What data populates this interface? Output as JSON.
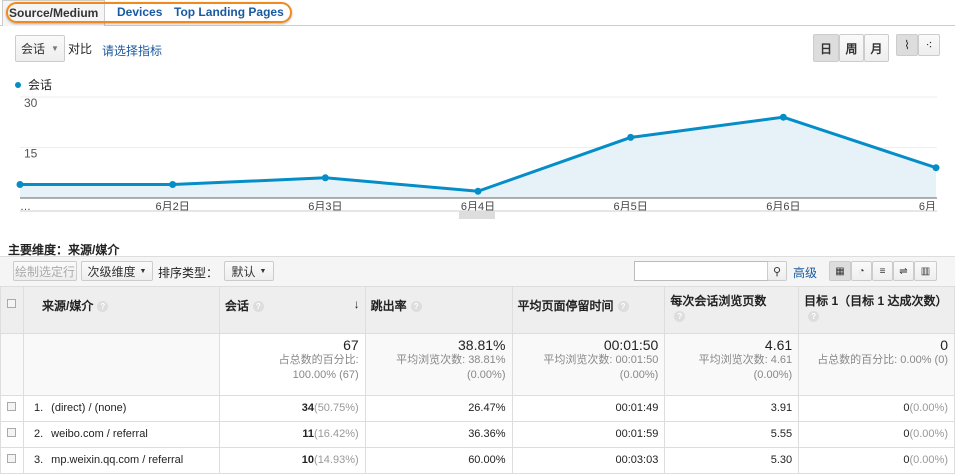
{
  "tabs": [
    "Source/Medium",
    "Devices",
    "Top Landing Pages"
  ],
  "metric_select": "会话",
  "compare_label": "对比",
  "choose_metric": "请选择指标",
  "period": [
    "日",
    "周",
    "月"
  ],
  "legend": "会话",
  "chart_data": {
    "type": "line",
    "series": [
      {
        "name": "会话",
        "values": [
          4,
          4,
          6,
          2,
          18,
          24,
          9
        ]
      }
    ],
    "categories": [
      "…",
      "6月2日",
      "6月3日",
      "6月4日",
      "6月5日",
      "6月6日",
      "6月"
    ],
    "yticks": [
      "30",
      "15"
    ],
    "ylim": [
      0,
      30
    ],
    "color": "#058dc7"
  },
  "primary_dim_label": "主要维度：",
  "primary_dim": "来源/媒介",
  "toolbar": {
    "plot_rows": "绘制选定行",
    "secondary": "次级维度",
    "sort_label": "排序类型：",
    "sort": "默认",
    "advanced": "高级",
    "search_placeholder": ""
  },
  "columns": [
    "来源/媒介",
    "会话",
    "跳出率",
    "平均页面停留时间",
    "每次会话浏览页数",
    "目标 1（目标 1 达成次数）"
  ],
  "totals": {
    "sessions": "67",
    "sessions_sub1": "占总数的百分比:",
    "sessions_sub2": "100.00% (67)",
    "bounce": "38.81%",
    "bounce_sub1": "平均浏览次数: 38.81%",
    "bounce_sub2": "(0.00%)",
    "time": "00:01:50",
    "time_sub1": "平均浏览次数: 00:01:50",
    "time_sub2": "(0.00%)",
    "pages": "4.61",
    "pages_sub1": "平均浏览次数: 4.61",
    "pages_sub2": "(0.00%)",
    "goal": "0",
    "goal_sub1": "占总数的百分比: 0.00% (0)"
  },
  "rows": [
    {
      "idx": "1.",
      "src": "(direct) / (none)",
      "sessions": "34",
      "pct": "(50.75%)",
      "bounce": "26.47%",
      "time": "00:01:49",
      "pages": "3.91",
      "goal": "0",
      "goal_pct": "(0.00%)"
    },
    {
      "idx": "2.",
      "src": "weibo.com / referral",
      "sessions": "11",
      "pct": "(16.42%)",
      "bounce": "36.36%",
      "time": "00:01:59",
      "pages": "5.55",
      "goal": "0",
      "goal_pct": "(0.00%)"
    },
    {
      "idx": "3.",
      "src": "mp.weixin.qq.com / referral",
      "sessions": "10",
      "pct": "(14.93%)",
      "bounce": "60.00%",
      "time": "00:03:03",
      "pages": "5.30",
      "goal": "0",
      "goal_pct": "(0.00%)"
    }
  ]
}
